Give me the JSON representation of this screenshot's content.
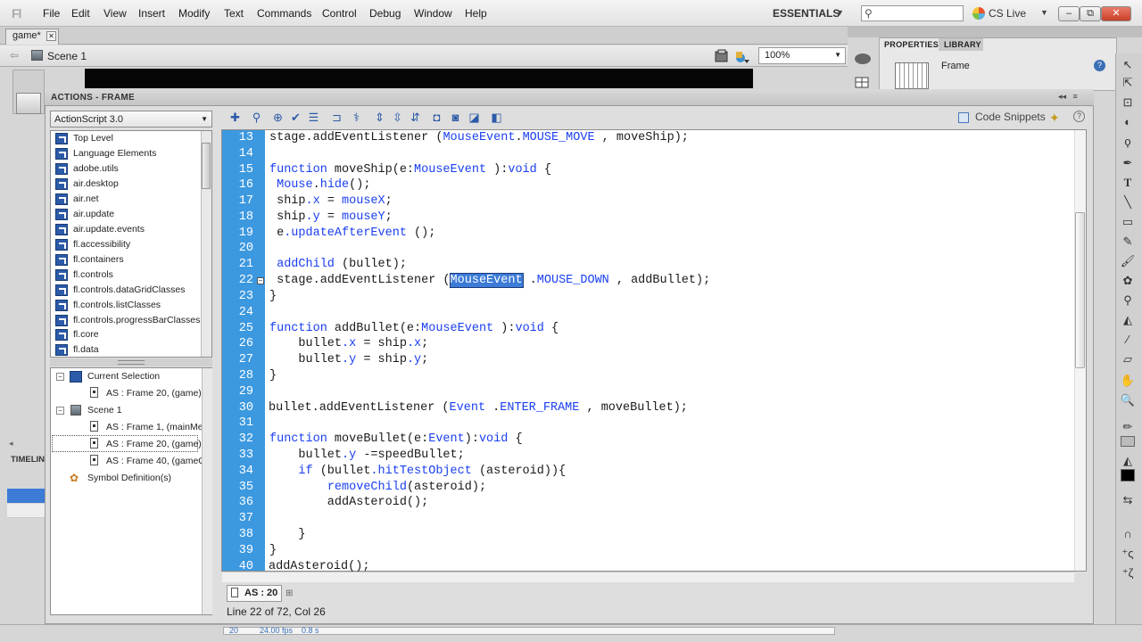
{
  "app": {
    "logo": "Fl"
  },
  "menu": [
    "File",
    "Edit",
    "View",
    "Insert",
    "Modify",
    "Text",
    "Commands",
    "Control",
    "Debug",
    "Window",
    "Help"
  ],
  "workspace": {
    "label": "ESSENTIALS"
  },
  "search": {
    "icon": "search-icon"
  },
  "cslive": {
    "label": "CS Live"
  },
  "window_buttons": {
    "minimize": "–",
    "restore": "⧉",
    "close": "✕"
  },
  "document": {
    "tab": "game*",
    "scene": "Scene 1",
    "zoom": "100%"
  },
  "properties": {
    "tab_properties": "PROPERTIES",
    "tab_library": "LIBRARY",
    "frame_label": "Frame"
  },
  "actions": {
    "title": "ACTIONS - FRAME",
    "language": "ActionScript 3.0",
    "code_snippets": "Code Snippets",
    "library_items": [
      "Top Level",
      "Language Elements",
      "adobe.utils",
      "air.desktop",
      "air.net",
      "air.update",
      "air.update.events",
      "fl.accessibility",
      "fl.containers",
      "fl.controls",
      "fl.controls.dataGridClasses",
      "fl.controls.listClasses",
      "fl.controls.progressBarClasses",
      "fl.core",
      "fl.data"
    ],
    "navigator": {
      "current_selection": "Current Selection",
      "current_frame": "AS : Frame 20, (game)",
      "scene": "Scene 1",
      "frames": [
        "AS : Frame 1, (mainMe",
        "AS : Frame 20, (game)",
        "AS : Frame 40, (gameO"
      ],
      "symbols": "Symbol Definition(s)"
    },
    "script_tab": "AS : 20",
    "status": "Line 22 of 72, Col 26"
  },
  "code": {
    "line_numbers": [
      "13",
      "14",
      "15",
      "16",
      "17",
      "18",
      "19",
      "20",
      "21",
      "22",
      "23",
      "24",
      "25",
      "26",
      "27",
      "28",
      "29",
      "30",
      "31",
      "32",
      "33",
      "34",
      "35",
      "36",
      "37",
      "38",
      "39",
      "40"
    ],
    "lines": {
      "l13a": "stage.addEventListener (",
      "l13b": "MouseEvent",
      "l13c": ".",
      "l13d": "MOUSE_MOVE",
      "l13e": " , moveShip);",
      "l15a": "function",
      "l15b": " moveShip(e:",
      "l15c": "MouseEvent",
      "l15d": " ):",
      "l15e": "void",
      "l15f": " {",
      "l16a": " Mouse",
      "l16b": ".",
      "l16c": "hide",
      "l16d": "();",
      "l17a": " ship",
      "l17b": ".x",
      "l17c": " = ",
      "l17d": "mouseX",
      "l17e": ";",
      "l18a": " ship",
      "l18b": ".y",
      "l18c": " = ",
      "l18d": "mouseY",
      "l18e": ";",
      "l19a": " e",
      "l19b": ".updateAfterEvent",
      "l19c": " ();",
      "l21a": " addChild",
      "l21b": " (bullet);",
      "l22a": " stage.addEventListener (",
      "l22b": "MouseEvent",
      "l22c": " .",
      "l22d": "MOUSE_DOWN",
      "l22e": " , addBullet);",
      "l23": "}",
      "l25a": "function",
      "l25b": " addBullet(e:",
      "l25c": "MouseEvent",
      "l25d": " ):",
      "l25e": "void",
      "l25f": " {",
      "l26a": "    bullet",
      "l26b": ".x",
      "l26c": " = ship",
      "l26d": ".x",
      "l26e": ";",
      "l27a": "    bullet",
      "l27b": ".y",
      "l27c": " = ship",
      "l27d": ".y",
      "l27e": ";",
      "l28": "}",
      "l30a": "bullet.addEventListener (",
      "l30b": "Event",
      "l30c": " .",
      "l30d": "ENTER_FRAME",
      "l30e": " , moveBullet);",
      "l32a": "function",
      "l32b": " moveBullet(e:",
      "l32c": "Event",
      "l32d": "):",
      "l32e": "void",
      "l32f": " {",
      "l33a": "    bullet",
      "l33b": ".y",
      "l33c": " -=speedBullet;",
      "l34a": "    ",
      "l34b": "if",
      "l34c": " (bullet",
      "l34d": ".hitTestObject",
      "l34e": " (asteroid)){",
      "l35a": "        ",
      "l35b": "removeChild",
      "l35c": "(asteroid);",
      "l36": "        addAsteroid();",
      "l38": "    }",
      "l39": "}",
      "l40": "addAsteroid();"
    }
  },
  "timeline": {
    "label": "TIMELIN",
    "frame": "20",
    "fps": "24.00 fps",
    "time": "0.8 s"
  },
  "colors": {
    "gutter": "#3c99e0",
    "keyword": "#1a3ff0",
    "selection": "#3c7bd6"
  }
}
